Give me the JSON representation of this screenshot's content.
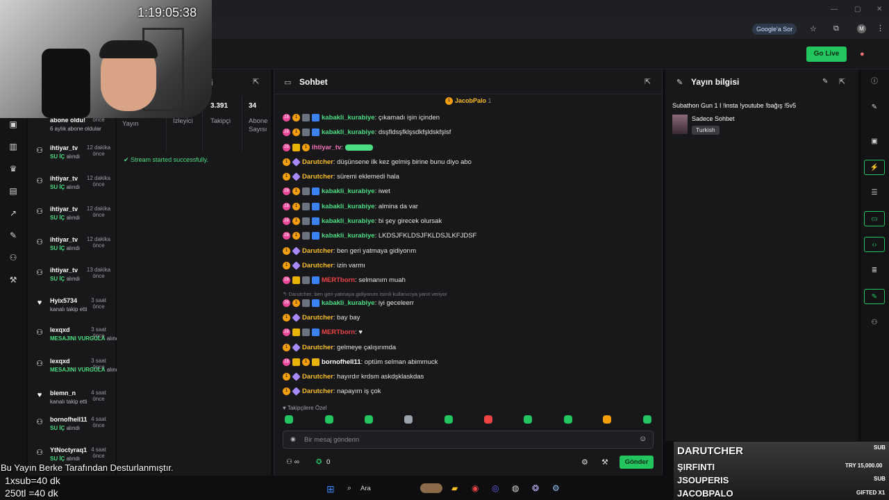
{
  "browser": {
    "google_pill": "Google'a Sor",
    "profile": "M"
  },
  "app": {
    "go_live": "Go Live"
  },
  "feed": {
    "items": [
      {
        "name": "abone oldu!",
        "time": "önce",
        "sub": "6 aylık abone oldular",
        "icon": "dot"
      },
      {
        "name": "ihtiyar_tv",
        "time": "12 dakika önce",
        "sub_bold": "SU İÇ",
        "sub": "alındı",
        "icon": "people-icon"
      },
      {
        "name": "ihtiyar_tv",
        "time": "12 dakika önce",
        "sub_bold": "SU İÇ",
        "sub": "alındı",
        "icon": "people-icon"
      },
      {
        "name": "ihtiyar_tv",
        "time": "12 dakika önce",
        "sub_bold": "SU İÇ",
        "sub": "alındı",
        "icon": "people-icon"
      },
      {
        "name": "ihtiyar_tv",
        "time": "12 dakika önce",
        "sub_bold": "SU İÇ",
        "sub": "alındı",
        "icon": "people-icon"
      },
      {
        "name": "ihtiyar_tv",
        "time": "13 dakika önce",
        "sub_bold": "SU İÇ",
        "sub": "alındı",
        "icon": "people-icon"
      },
      {
        "name": "Hyix5734",
        "time": "3 saat önce",
        "sub": "kanalı takip etti",
        "icon": "heart-icon"
      },
      {
        "name": "lexqxd",
        "time": "3 saat önce",
        "sub_bold": "MESAJINI VURGULA",
        "sub": "alındı",
        "icon": "people-icon"
      },
      {
        "name": "lexqxd",
        "time": "3 saat önce",
        "sub_bold": "MESAJINI VURGULA",
        "sub": "alındı",
        "icon": "people-icon"
      },
      {
        "name": "blemn_n",
        "time": "4 saat önce",
        "sub": "kanalı takip etti",
        "icon": "heart-icon"
      },
      {
        "name": "bornofhell11",
        "time": "4 saat önce",
        "sub_bold": "SU İÇ",
        "sub": "alındı",
        "icon": "people-icon"
      },
      {
        "name": "YtNoctyraq1",
        "time": "4 saat önce",
        "sub_bold": "SU İÇ",
        "sub": "alındı",
        "icon": "people-icon"
      }
    ]
  },
  "stats": {
    "values": [
      "3.391",
      "34"
    ],
    "labels": [
      "Yayın",
      "İzleyici",
      "Takipçi",
      "Abone Sayısı"
    ],
    "success": "Stream started successfully."
  },
  "chat": {
    "title": "Sohbet",
    "pinned": "JacobPalo",
    "pinned_count": "1",
    "reply": "Darutcher: ben geri yatmaya gidiyorum isimli kullanıcıya yanıt veriyor",
    "messages": [
      {
        "user": "kabakli_kurabiye",
        "text": "çıkamadı işin içinden",
        "color": "green",
        "badges": [
          "pink",
          "gold",
          "gray",
          "blue"
        ]
      },
      {
        "user": "kabakli_kurabiye",
        "text": "dsşfldsşfklşsdkfşldskfşlsf",
        "color": "green",
        "badges": [
          "pink",
          "gold",
          "gray",
          "blue"
        ]
      },
      {
        "user": "ihtiyar_tv",
        "text": "",
        "color": "pink",
        "badges": [
          "pink",
          "crown",
          "gold"
        ]
      },
      {
        "user": "Darutcher",
        "text": "düşünsene ilk kez gelmiş birine bunu diyo abo",
        "color": "yellow",
        "badges": [
          "gold",
          "diamond"
        ]
      },
      {
        "user": "Darutcher",
        "text": "süremi eklemedi hala",
        "color": "yellow",
        "badges": [
          "gold",
          "diamond"
        ]
      },
      {
        "user": "kabakli_kurabiye",
        "text": "iwet",
        "color": "green",
        "badges": [
          "pink",
          "gold",
          "gray",
          "blue"
        ]
      },
      {
        "user": "kabakli_kurabiye",
        "text": "almina da var",
        "color": "green",
        "badges": [
          "pink",
          "gold",
          "gray",
          "blue"
        ]
      },
      {
        "user": "kabakli_kurabiye",
        "text": "bi şey girecek olursak",
        "color": "green",
        "badges": [
          "pink",
          "gold",
          "gray",
          "blue"
        ]
      },
      {
        "user": "kabakli_kurabiye",
        "text": "LKDSJFKLDSJFKLDSJLKFJDSF",
        "color": "green",
        "badges": [
          "pink",
          "gold",
          "gray",
          "blue"
        ]
      },
      {
        "user": "Darutcher",
        "text": "ben geri yatmaya gidiyorım",
        "color": "yellow",
        "badges": [
          "gold",
          "diamond"
        ]
      },
      {
        "user": "Darutcher",
        "text": "izin varmı",
        "color": "yellow",
        "badges": [
          "gold",
          "diamond"
        ]
      },
      {
        "user": "MERTborn",
        "text": "selmanım muah",
        "color": "red",
        "badges": [
          "pink",
          "crown",
          "gray",
          "blue"
        ]
      },
      {
        "user": "kabakli_kurabiye",
        "text": "iyi geceleerr",
        "color": "green",
        "badges": [
          "pink",
          "gold",
          "gray",
          "blue"
        ]
      },
      {
        "user": "Darutcher",
        "text": "bay bay",
        "color": "yellow",
        "badges": [
          "gold",
          "diamond"
        ]
      },
      {
        "user": "MERTborn",
        "text": "♥",
        "color": "red",
        "badges": [
          "pink",
          "crown",
          "gray",
          "blue"
        ]
      },
      {
        "user": "Darutcher",
        "text": "gelmeye çalışırımda",
        "color": "yellow",
        "badges": [
          "gold",
          "diamond"
        ]
      },
      {
        "user": "bornofhell11",
        "text": "optüm selman abimmuck",
        "color": "white",
        "badges": [
          "pink",
          "crown",
          "gold",
          "crown"
        ]
      },
      {
        "user": "Darutcher",
        "text": "hayırdır krdsm askdşklaskdas",
        "color": "yellow",
        "badges": [
          "gold",
          "diamond"
        ]
      },
      {
        "user": "Darutcher",
        "text": "napayım iş çok",
        "color": "yellow",
        "badges": [
          "gold",
          "diamond"
        ]
      }
    ],
    "followers_only": "Takipçilere Özel",
    "input_placeholder": "Bir mesaj gönderin",
    "viewer_count": "0",
    "send": "Gönder"
  },
  "info": {
    "title": "Yayın bilgisi",
    "stream_title": "Subathon Gun 1 I !insta !youtube !bağış !5v5",
    "category": "Sadece Sohbet",
    "language": "Turkish"
  },
  "overlay": {
    "timer": "1:19:05:38",
    "line1": "Bu Yayın Berke Tarafından Desturlanmıştır.",
    "line2": "1xsub=40 dk",
    "line3": "250tl =40 dk",
    "subs": [
      "DARUTCHER",
      "ŞIRFINTI",
      "JSOUPERIS",
      "JACOBPALO"
    ],
    "sub_tag": "SUB",
    "amount": "TRY 15,000.00",
    "gifted": "GIFTED X1"
  },
  "taskbar": {
    "search": "Ara"
  }
}
